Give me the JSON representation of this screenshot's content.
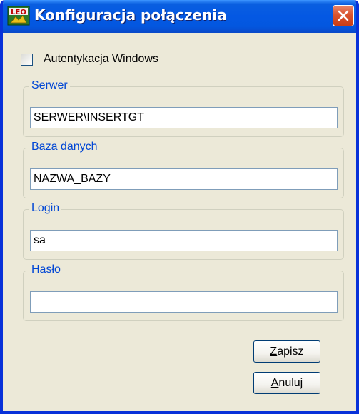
{
  "window": {
    "title": "Konfiguracja połączenia",
    "title_color": "#ffffff",
    "accent": "#0458e3"
  },
  "icons": {
    "app": "app-logo-icon",
    "close": "close-icon"
  },
  "windows_auth": {
    "label": "Autentykacja Windows",
    "checked": false
  },
  "server": {
    "legend": "Serwer",
    "value": "SERWER\\INSERTGT"
  },
  "database": {
    "legend": "Baza danych",
    "value": "NAZWA_BAZY"
  },
  "login": {
    "legend": "Login",
    "value": "sa"
  },
  "password": {
    "legend": "Hasło",
    "value": ""
  },
  "buttons": {
    "save": {
      "mnemonic": "Z",
      "rest": "apisz"
    },
    "cancel": {
      "mnemonic": "A",
      "rest": "nuluj"
    }
  }
}
